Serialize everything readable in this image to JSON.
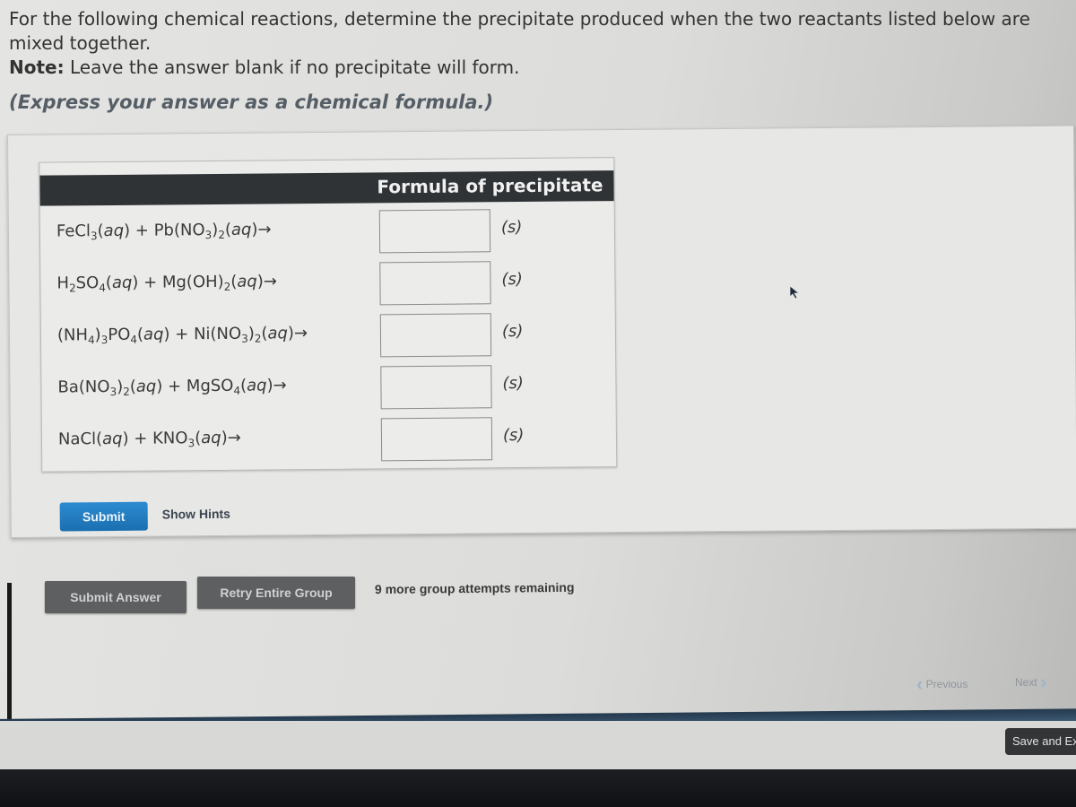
{
  "instructions": {
    "line1": "For the following chemical reactions, determine the precipitate produced when the two reactants listed below are mixed together.",
    "note_label": "Note:",
    "note_text": " Leave the answer blank if no precipitate will form.",
    "express": "(Express your answer as a chemical formula.)"
  },
  "table": {
    "header": "Formula of precipitate",
    "rows": [
      {
        "reaction": "FeCl3(aq) + Pb(NO3)2(aq)→",
        "answer": "",
        "state": "(s)"
      },
      {
        "reaction": "H2SO4(aq) + Mg(OH)2(aq)→",
        "answer": "",
        "state": "(s)"
      },
      {
        "reaction": "(NH4)3PO4(aq) + Ni(NO3)2(aq)→",
        "answer": "",
        "state": "(s)"
      },
      {
        "reaction": "Ba(NO3)2(aq) + MgSO4(aq)→",
        "answer": "",
        "state": "(s)"
      },
      {
        "reaction": "NaCl(aq) + KNO3(aq)→",
        "answer": "",
        "state": "(s)"
      }
    ]
  },
  "actions": {
    "submit": "Submit",
    "show_hints": "Show Hints",
    "submit_answer": "Submit Answer",
    "retry_group": "Retry Entire Group",
    "attempts_remaining": "9 more group attempts remaining"
  },
  "navigation": {
    "previous": "Previous",
    "next": "Next",
    "save_exit": "Save and Exit"
  },
  "colors": {
    "submit_blue": "#1f78bd",
    "header_dark": "#2f3336",
    "gray_button": "#5d5f61"
  }
}
